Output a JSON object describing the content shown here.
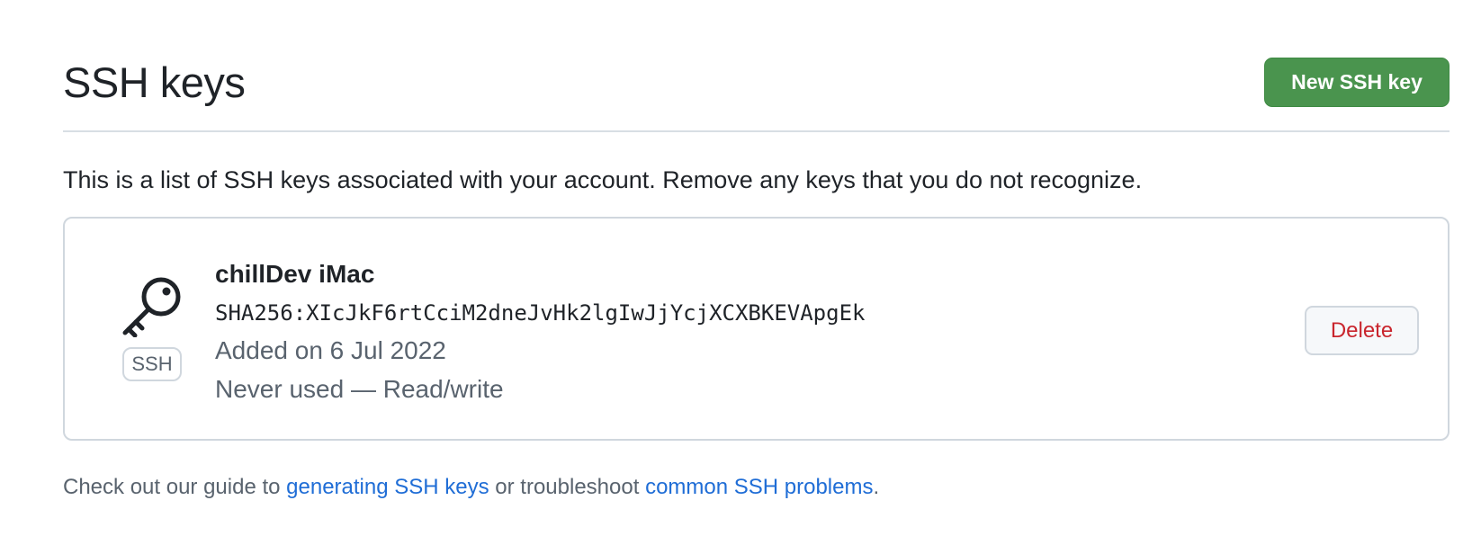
{
  "header": {
    "title": "SSH keys",
    "new_key_label": "New SSH key"
  },
  "intro": {
    "text": "This is a list of SSH keys associated with your account. Remove any keys that you do not recognize."
  },
  "keys": [
    {
      "title": "chillDev iMac",
      "type": "SSH",
      "icon": "key-icon",
      "fingerprint": "SHA256:XIcJkF6rtCciM2dneJvHk2lgIwJjYcjXCXBKEVApgEk",
      "added": "Added on 6 Jul 2022",
      "usage": "Never used — Read/write",
      "delete_label": "Delete"
    }
  ],
  "footer": {
    "prefix": "Check out our guide to ",
    "link_generating": "generating SSH keys",
    "middle": " or troubleshoot ",
    "link_problems": "common SSH problems",
    "suffix": "."
  },
  "colors": {
    "primary_button": "#4a944e",
    "danger_text": "#c9252d",
    "link": "#1f6dd6",
    "muted_text": "#59636e",
    "border": "#d0d7de"
  }
}
